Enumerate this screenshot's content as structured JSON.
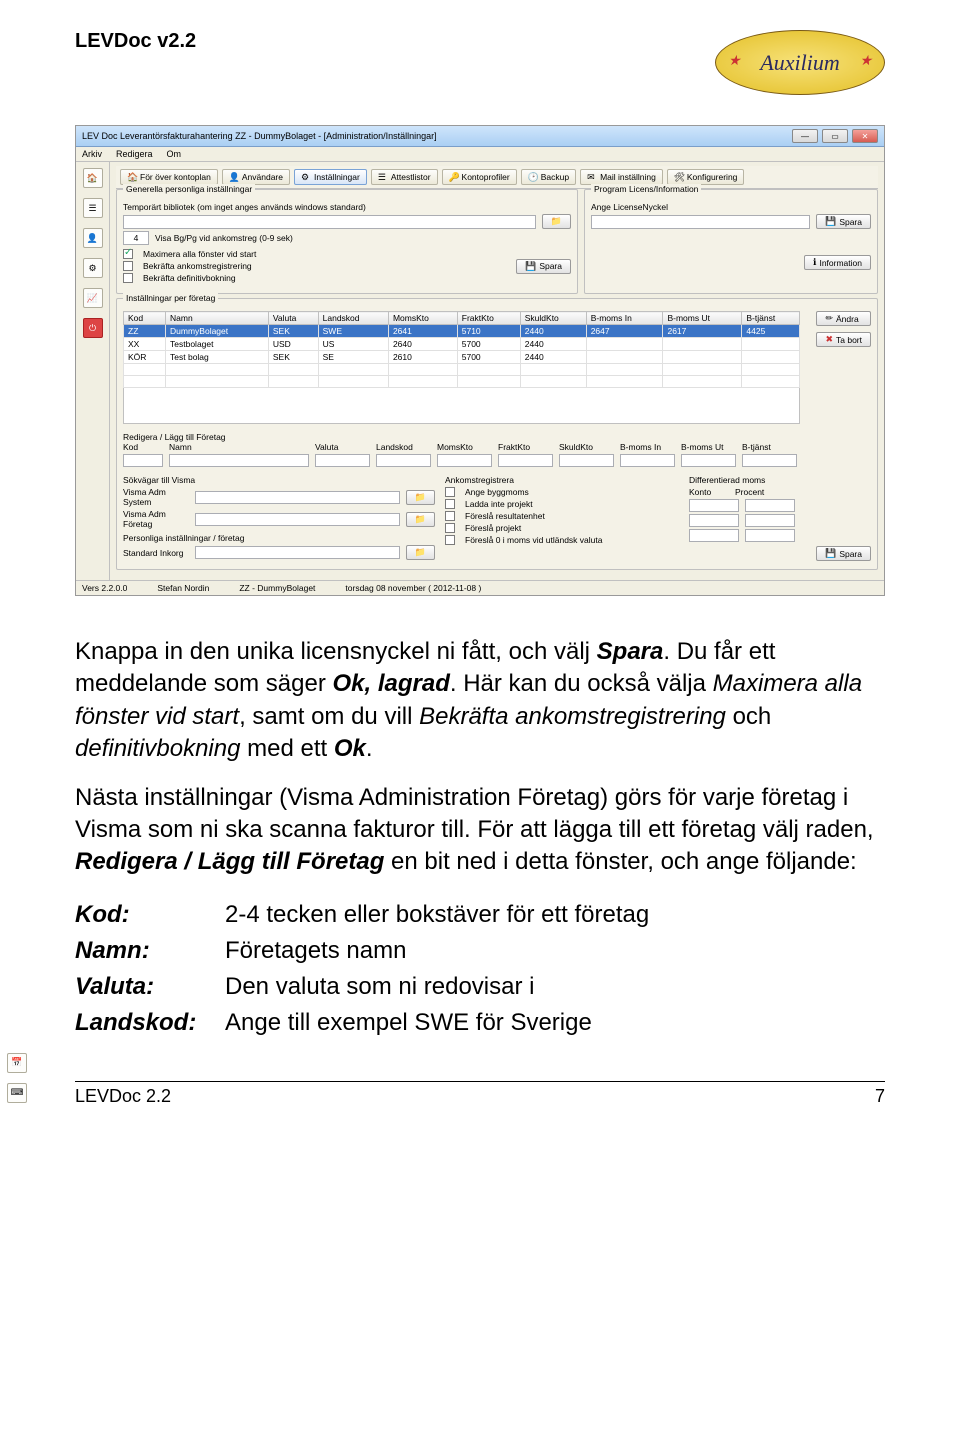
{
  "doc": {
    "title": "LEVDoc v2.2",
    "logo_text": "Auxilium",
    "footer_left": "LEVDoc 2.2",
    "footer_right": "7"
  },
  "screenshot": {
    "window_title": "LEV Doc Leverantörsfakturahantering  ZZ - DummyBolaget - [Administration/Inställningar]",
    "menu": [
      "Arkiv",
      "Redigera",
      "Om"
    ],
    "toolbar": [
      {
        "label": "För över kontoplan"
      },
      {
        "label": "Användare"
      },
      {
        "label": "Inställningar"
      },
      {
        "label": "Attestlistor"
      },
      {
        "label": "Kontoprofiler"
      },
      {
        "label": "Backup"
      },
      {
        "label": "Mail inställning"
      },
      {
        "label": "Konfigurering"
      }
    ],
    "left_group_title": "Generella personliga inställningar",
    "temp_lib_label": "Temporärt bibliotek (om inget anges används windows standard)",
    "spin_value": "4",
    "visa_bgpg_label": "Visa Bg/Pg vid ankomstreg (0-9 sek)",
    "chk_max": "Maximera alla fönster vid start",
    "chk_bekr_ank": "Bekräfta ankomstregistrering",
    "chk_bekr_def": "Bekräfta definitivbokning",
    "btn_spara": "Spara",
    "right_group_title": "Program Licens/Information",
    "ange_licens_label": "Ange LicenseNyckel",
    "btn_info": "Information",
    "grid_title": "Inställningar per företag",
    "columns": [
      "Kod",
      "Namn",
      "Valuta",
      "Landskod",
      "MomsKto",
      "FraktKto",
      "SkuldKto",
      "B-moms In",
      "B-moms Ut",
      "B-tjänst"
    ],
    "rows": [
      {
        "Kod": "ZZ",
        "Namn": "DummyBolaget",
        "Valuta": "SEK",
        "Landskod": "SWE",
        "MomsKto": "2641",
        "FraktKto": "5710",
        "SkuldKto": "2440",
        "BmomsIn": "2647",
        "BmomsUt": "2617",
        "Btjanst": "4425",
        "selected": true
      },
      {
        "Kod": "XX",
        "Namn": "Testbolaget",
        "Valuta": "USD",
        "Landskod": "US",
        "MomsKto": "2640",
        "FraktKto": "5700",
        "SkuldKto": "2440",
        "BmomsIn": "",
        "BmomsUt": "",
        "Btjanst": ""
      },
      {
        "Kod": "KÖR",
        "Namn": "Test bolag",
        "Valuta": "SEK",
        "Landskod": "SE",
        "MomsKto": "2610",
        "FraktKto": "5700",
        "SkuldKto": "2440",
        "BmomsIn": "",
        "BmomsUt": "",
        "Btjanst": ""
      }
    ],
    "btn_andra": "Ändra",
    "btn_tabort": "Ta bort",
    "redigera_title": "Redigera / Lägg till Företag",
    "sok_title": "Sökvägar till Visma",
    "visma_adm_system": "Visma Adm System",
    "visma_adm_foretag": "Visma Adm Företag",
    "pers_title": "Personliga inställningar / företag",
    "standard_inkorg": "Standard Inkorg",
    "ank_title": "Ankomstregistrera",
    "ank_checks": [
      "Ange byggmoms",
      "Ladda inte projekt",
      "Föreslå resultatenhet",
      "Föreslå projekt",
      "Föreslå 0 i moms vid utländsk valuta"
    ],
    "diff_title": "Differentierad moms",
    "diff_cols": [
      "Konto",
      "Procent"
    ],
    "statusbar": {
      "version": "Vers 2.2.0.0",
      "user": "Stefan Nordin",
      "company": "ZZ - DummyBolaget",
      "date": "torsdag 08 november ( 2012-11-08 )"
    }
  },
  "para1": {
    "t1": "Knappa in den unika licensnyckel ni fått, och välj ",
    "spara": "Spara",
    "t2": ". Du får ett meddelande som säger ",
    "ok_lagrad": "Ok, lagrad",
    "t3": ". Här kan du också välja ",
    "max": "Maximera alla fönster vid start",
    "t4": ", samt om du vill ",
    "bekr": "Bekräfta ankomstregistrering",
    "t5": " och ",
    "defb": "definitivbokning",
    "t6": " med ett ",
    "ok": "Ok",
    "t7": "."
  },
  "para2": {
    "t1": "Nästa inställningar (Visma Administration Företag) görs för varje företag i Visma som ni ska scanna fakturor till. För att lägga till ett företag välj raden, ",
    "redig": "Redigera / Lägg till Företag",
    "t2": " en bit ned i detta fönster, och ange följande:"
  },
  "defs": [
    {
      "k": "Kod",
      "v": "2-4 tecken eller bokstäver för ett företag"
    },
    {
      "k": "Namn",
      "v": "Företagets namn"
    },
    {
      "k": "Valuta",
      "v": "Den valuta som ni redovisar i"
    },
    {
      "k": "Landskod",
      "v": "Ange till exempel SWE för Sverige"
    }
  ]
}
